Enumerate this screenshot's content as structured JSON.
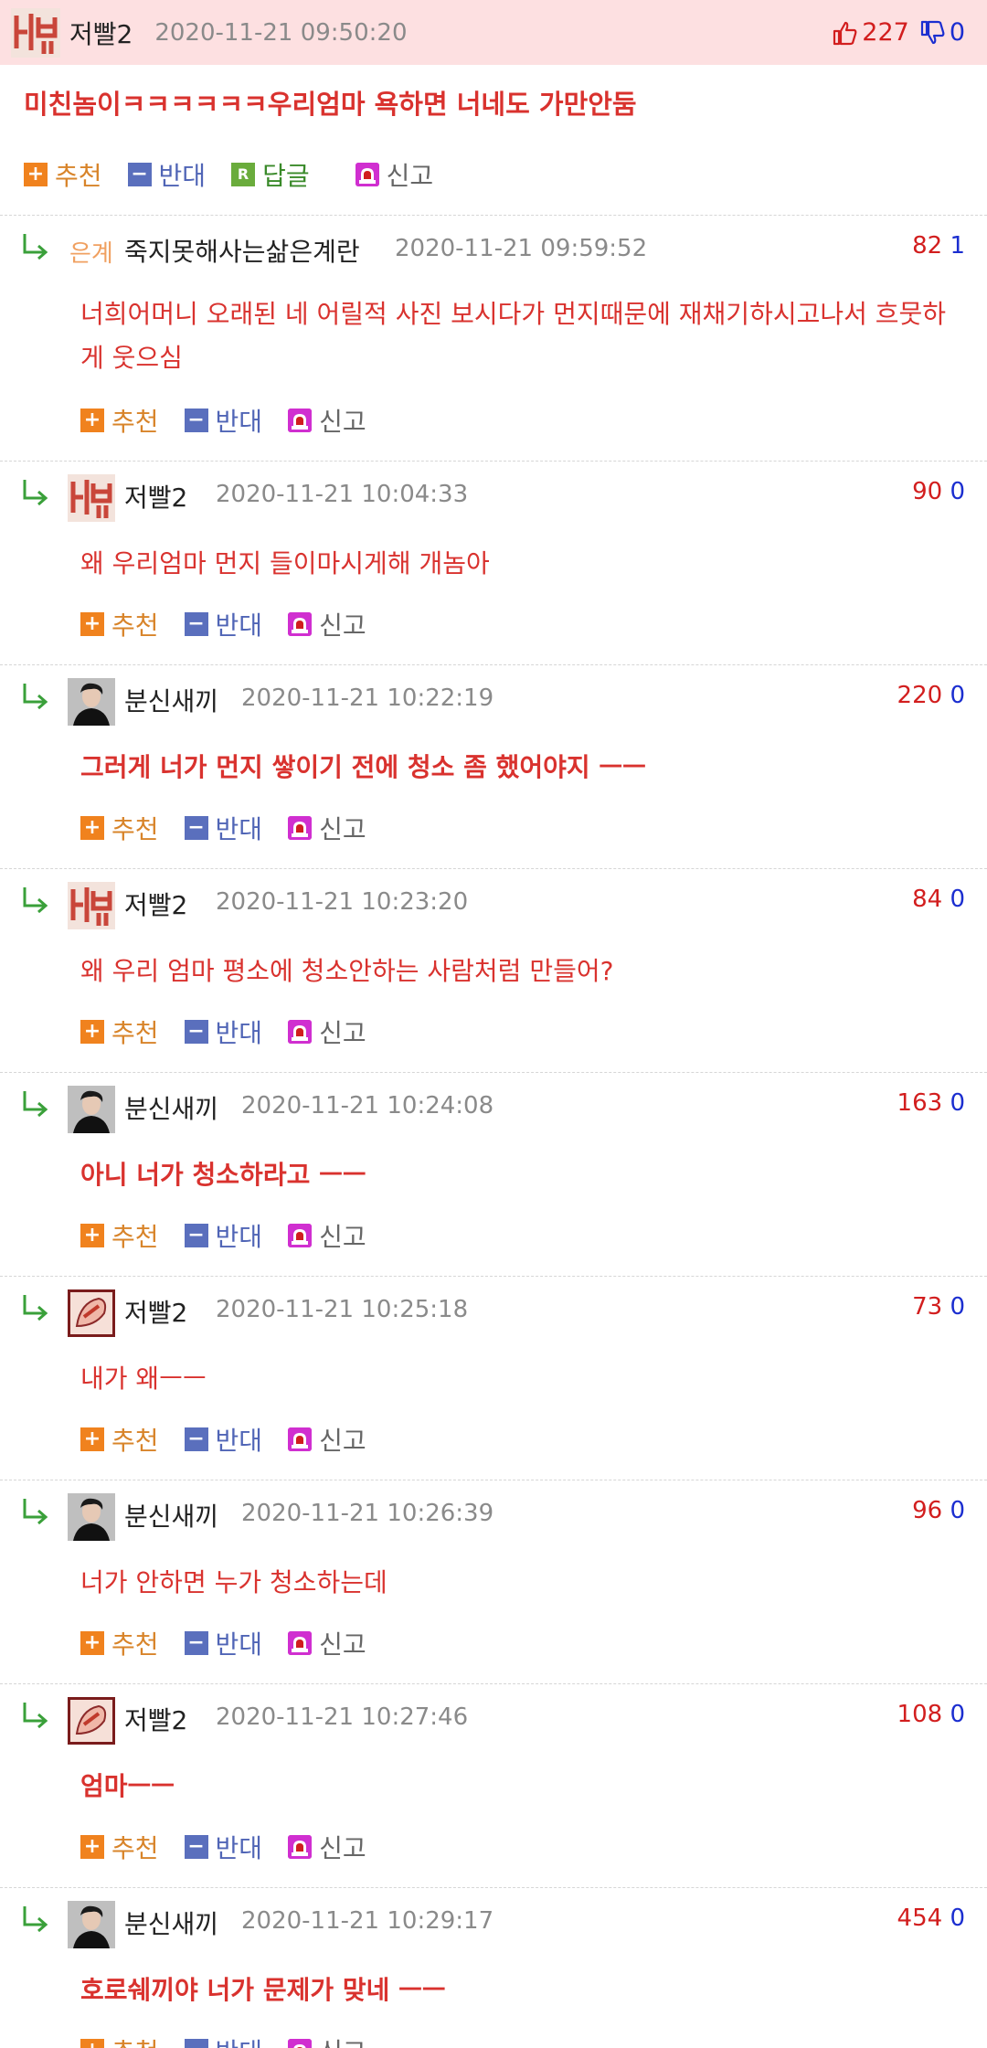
{
  "colors": {
    "header_bg": "#fde0e1",
    "comment_text": "#d9322e",
    "up_count": "#d21e1e",
    "down_count": "#1b2ed0",
    "plus_icon": "#f0821e",
    "minus_icon": "#5a6fbd",
    "reply_icon": "#6aac3c",
    "report_icon": "#d02fd0",
    "reply_arrow": "#3aa03a"
  },
  "top_post": {
    "nickname": "저빨2",
    "date": "2020-11-21 09:50:20",
    "up": "227",
    "down": "0",
    "text": "미친놈이ㅋㅋㅋㅋㅋㅋ우리엄마 욕하면 너네도 가만안둠",
    "actions": {
      "up": "추천",
      "down": "반대",
      "reply": "답글",
      "report": "신고"
    },
    "avatar_icon": "avatar-image"
  },
  "action_labels": {
    "up": "추천",
    "down": "반대",
    "report": "신고"
  },
  "comments": [
    {
      "nickname": "죽지못해사는삶은계란",
      "date": "2020-11-21 09:59:52",
      "up": "82",
      "down": "1",
      "text": "너희어머니 오래된 네 어릴적 사진 보시다가 먼지때문에 재채기하시고나서 흐뭇하게 웃으심",
      "bold": false,
      "avatar_icon": "avatar-egg-text"
    },
    {
      "nickname": "저빨2",
      "date": "2020-11-21 10:04:33",
      "up": "90",
      "down": "0",
      "text": "왜 우리엄마 먼지 들이마시게해 개놈아",
      "bold": false,
      "avatar_icon": "avatar-image"
    },
    {
      "nickname": "분신새끼",
      "date": "2020-11-21 10:22:19",
      "up": "220",
      "down": "0",
      "text": "그러게 너가 먼지 쌓이기 전에 청소 좀 했어야지 ㅡㅡ",
      "bold": true,
      "avatar_icon": "avatar-photo"
    },
    {
      "nickname": "저빨2",
      "date": "2020-11-21 10:23:20",
      "up": "84",
      "down": "0",
      "text": "왜 우리 엄마 평소에 청소안하는 사람처럼 만들어?",
      "bold": false,
      "avatar_icon": "avatar-image"
    },
    {
      "nickname": "분신새끼",
      "date": "2020-11-21 10:24:08",
      "up": "163",
      "down": "0",
      "text": "아니 너가 청소하라고 ㅡㅡ",
      "bold": true,
      "avatar_icon": "avatar-photo"
    },
    {
      "nickname": "저빨2",
      "date": "2020-11-21 10:25:18",
      "up": "73",
      "down": "0",
      "text": "내가 왜ㅡㅡ",
      "bold": false,
      "avatar_icon": "avatar-image-alt"
    },
    {
      "nickname": "분신새끼",
      "date": "2020-11-21 10:26:39",
      "up": "96",
      "down": "0",
      "text": "너가 안하면 누가 청소하는데",
      "bold": false,
      "avatar_icon": "avatar-photo"
    },
    {
      "nickname": "저빨2",
      "date": "2020-11-21 10:27:46",
      "up": "108",
      "down": "0",
      "text": "엄마ㅡㅡ",
      "bold": true,
      "avatar_icon": "avatar-image-alt"
    },
    {
      "nickname": "분신새끼",
      "date": "2020-11-21 10:29:17",
      "up": "454",
      "down": "0",
      "text": "호로쉐끼야 너가 문제가 맞네 ㅡㅡ",
      "bold": true,
      "avatar_icon": "avatar-photo"
    }
  ]
}
